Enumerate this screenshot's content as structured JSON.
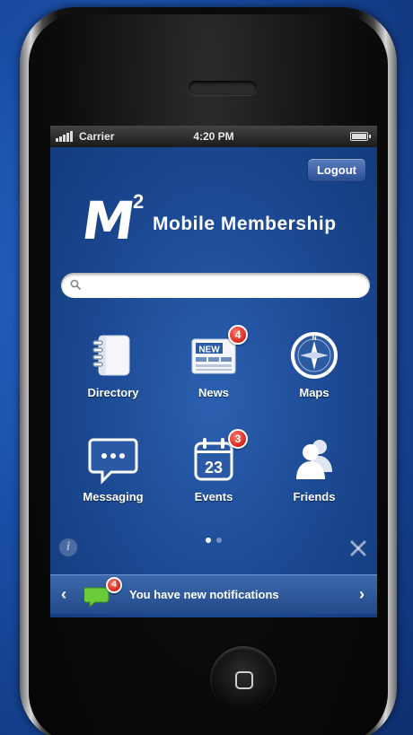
{
  "statusbar": {
    "carrier": "Carrier",
    "time": "4:20 PM"
  },
  "header": {
    "logout_label": "Logout"
  },
  "brand": {
    "mark": "M",
    "superscript": "2",
    "name": "Mobile Membership"
  },
  "search": {
    "placeholder": "",
    "value": ""
  },
  "grid": {
    "items": [
      {
        "label": "Directory",
        "icon": "notebook-icon"
      },
      {
        "label": "News",
        "icon": "newspaper-icon",
        "badge": "4"
      },
      {
        "label": "Maps",
        "icon": "compass-icon"
      },
      {
        "label": "Messaging",
        "icon": "speech-bubble-icon"
      },
      {
        "label": "Events",
        "icon": "calendar-icon",
        "badge": "3",
        "date": "23"
      },
      {
        "label": "Friends",
        "icon": "people-icon"
      }
    ],
    "news_text": "NEW"
  },
  "pager": {
    "current": 1,
    "total": 2
  },
  "notification": {
    "message": "You have new notifications",
    "badge": "4"
  },
  "colors": {
    "accent": "#1d4a94",
    "badge": "#d8231a",
    "bar": "#2f5a9c"
  }
}
